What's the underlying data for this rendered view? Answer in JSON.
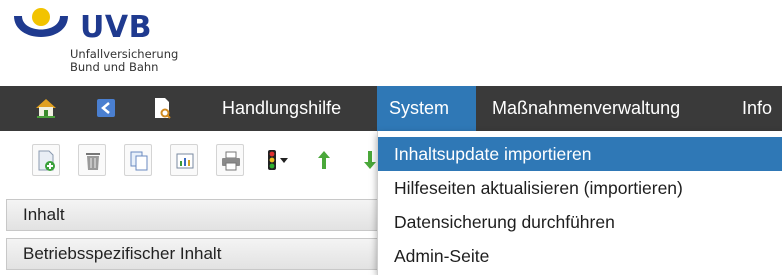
{
  "logo": {
    "main_text": "UVB",
    "sub_line1": "Unfallversicherung",
    "sub_line2": "Bund und Bahn"
  },
  "menubar": {
    "icons": [
      "home-icon",
      "back-icon",
      "document-search-icon"
    ],
    "items": [
      {
        "label": "Handlungshilfe",
        "active": false
      },
      {
        "label": "System",
        "active": true
      },
      {
        "label": "Maßnahmenverwaltung",
        "active": false
      },
      {
        "label": "Info",
        "active": false
      }
    ]
  },
  "toolbar": {
    "buttons": [
      "add-icon",
      "delete-icon",
      "copy-icon",
      "chart-icon",
      "print-icon",
      "traffic-light-dropdown-icon",
      "arrow-up-icon",
      "arrow-down-icon"
    ]
  },
  "tree": {
    "rows": [
      "Inhalt",
      "Betriebsspezifischer Inhalt"
    ]
  },
  "dropdown": {
    "items": [
      "Inhaltsupdate importieren",
      "Hilfeseiten aktualisieren (importieren)",
      "Datensicherung durchführen",
      "Admin-Seite"
    ]
  },
  "colors": {
    "menubar_bg": "#3a3a3a",
    "accent": "#2f78b6",
    "logo_blue": "#1f3a8f",
    "logo_yellow": "#f2c300"
  }
}
